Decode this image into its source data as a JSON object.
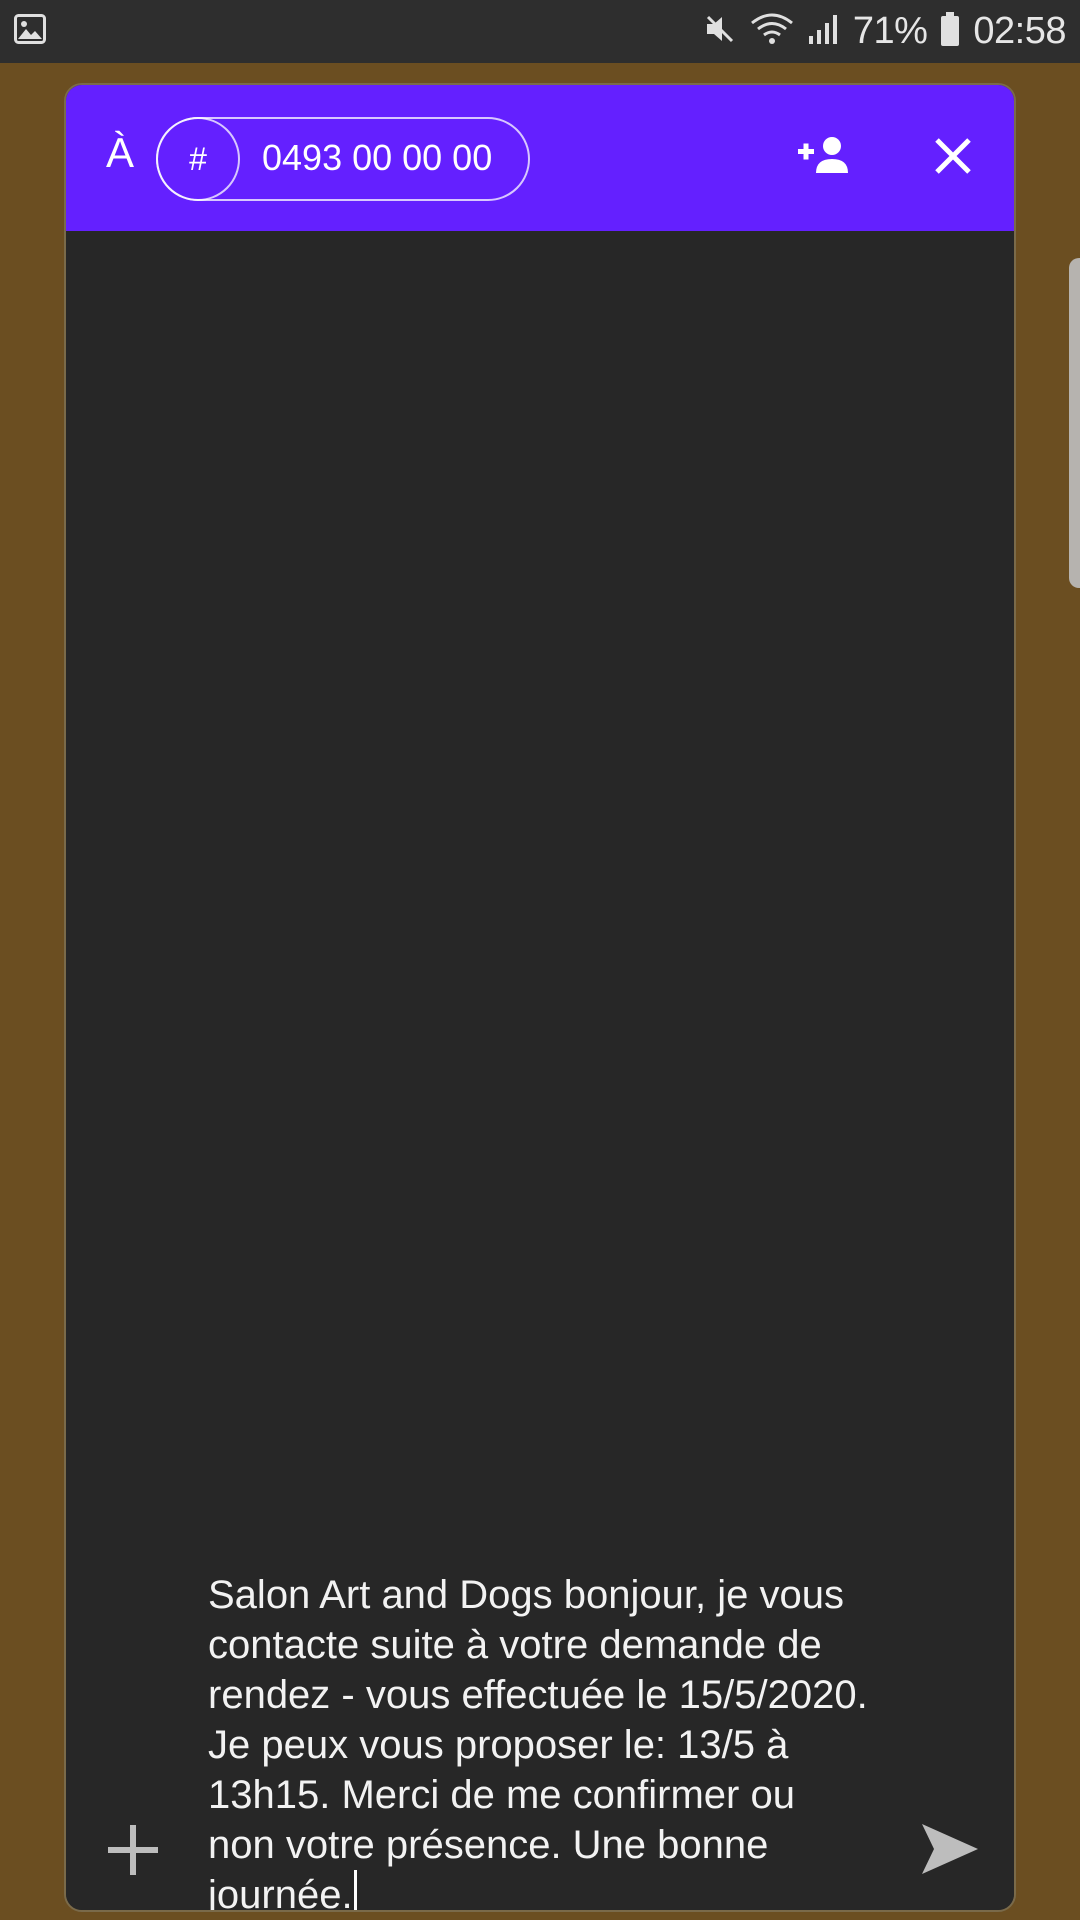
{
  "status_bar": {
    "battery_percent": "71%",
    "time": "02:58",
    "icons": [
      "gallery-icon",
      "mute-icon",
      "wifi-icon",
      "signal-icon",
      "battery-icon"
    ]
  },
  "header": {
    "to_label": "À",
    "chip_hash": "#",
    "recipient_number": "0493 00 00 00",
    "icons": [
      "add-contact-icon",
      "close-icon"
    ],
    "accent_color": "#6420FF"
  },
  "composer": {
    "message_text": "Salon Art and Dogs bonjour, je vous contacte suite à votre demande de rendez - vous effectuée le 15/5/2020. Je peux vous proposer le: 13/5 à 13h15. Merci de me confirmer ou non votre présence. Une bonne journée.",
    "icons": [
      "attach-plus-icon",
      "send-icon"
    ]
  },
  "colors": {
    "background": "#6B4E21",
    "card": "#272727",
    "status_bar": "#2E2E2E"
  }
}
